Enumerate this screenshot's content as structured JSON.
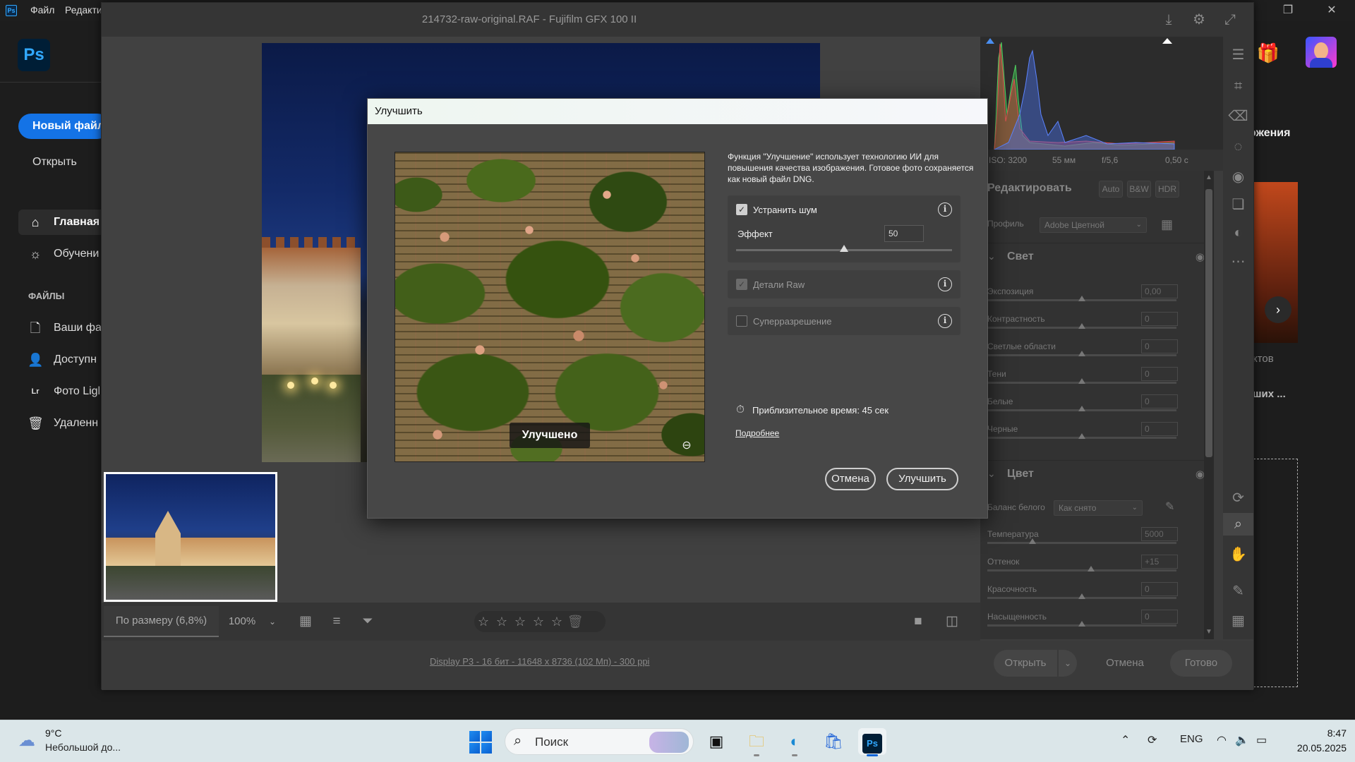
{
  "ps_window": {
    "menu": [
      "Файл",
      "Редакти"
    ],
    "logo": "Ps",
    "new_file": "Новый файл",
    "open": "Открыть",
    "nav": [
      {
        "label": "Главная",
        "icon": "home-icon"
      },
      {
        "label": "Обучени",
        "icon": "lightbulb-icon"
      }
    ],
    "files_header": "ФАЙЛЫ",
    "files": [
      {
        "label": "Ваши фа",
        "icon": "file-icon"
      },
      {
        "label": "Доступн",
        "icon": "people-icon"
      },
      {
        "label": "Фото Ligl",
        "icon": "lightroom-icon"
      },
      {
        "label": "Удаленн",
        "icon": "trash-icon"
      }
    ],
    "right_heading": "ожения",
    "right_label1": "ктов",
    "right_label2": "ших ..."
  },
  "camera_raw": {
    "title": "214732-raw-original.RAF  -  Fujifilm GFX 100 II",
    "exif": {
      "iso": "ISO: 3200",
      "focal": "55 мм",
      "aperture": "f/5,6",
      "shutter": "0,50 с"
    },
    "edit": {
      "title": "Редактировать",
      "modes": [
        "Auto",
        "B&W",
        "HDR"
      ],
      "profile_label": "Профиль",
      "profile_value": "Adobe Цветной"
    },
    "light": {
      "title": "Свет",
      "sliders": [
        {
          "label": "Экспозиция",
          "value": "0,00"
        },
        {
          "label": "Контрастность",
          "value": "0"
        },
        {
          "label": "Светлые области",
          "value": "0"
        },
        {
          "label": "Тени",
          "value": "0"
        },
        {
          "label": "Белые",
          "value": "0"
        },
        {
          "label": "Черные",
          "value": "0"
        }
      ]
    },
    "color": {
      "title": "Цвет",
      "wb_label": "Баланс белого",
      "wb_value": "Как снято",
      "sliders": [
        {
          "label": "Температура",
          "value": "5000",
          "level": 0.24
        },
        {
          "label": "Оттенок",
          "value": "+15",
          "level": 0.55
        },
        {
          "label": "Красочность",
          "value": "0",
          "level": 0.5
        },
        {
          "label": "Насыщенность",
          "value": "0",
          "level": 0.5
        }
      ]
    },
    "fit_label": "По размеру (6,8%)",
    "zoom": "100%",
    "display_info": "Display P3 - 16 бит - 11648 x 8736 (102 Мп) - 300 ppi",
    "footer": {
      "open": "Открыть",
      "cancel": "Отмена",
      "done": "Готово"
    }
  },
  "enhance_dialog": {
    "title": "Улучшить",
    "description": "Функция \"Улучшение\" использует технологию ИИ для повышения качества изображения. Готовое фото сохраняется как новый файл DNG.",
    "denoise": {
      "label": "Устранить шум",
      "checked": true,
      "effect_label": "Эффект",
      "effect_value": "50",
      "effect_level": 0.5
    },
    "raw_details": {
      "label": "Детали Raw",
      "checked": true,
      "disabled": true
    },
    "super_resolution": {
      "label": "Суперразрешение",
      "checked": false
    },
    "preview_badge": "Улучшено",
    "estimated_time": "Приблизительное время: 45 сек",
    "learn_more": "Подробнее",
    "cancel": "Отмена",
    "ok": "Улучшить"
  },
  "taskbar": {
    "weather_temp": "9°C",
    "weather_desc": "Небольшой до...",
    "search_placeholder": "Поиск",
    "lang": "ENG",
    "time": "8:47",
    "date": "20.05.2025"
  }
}
